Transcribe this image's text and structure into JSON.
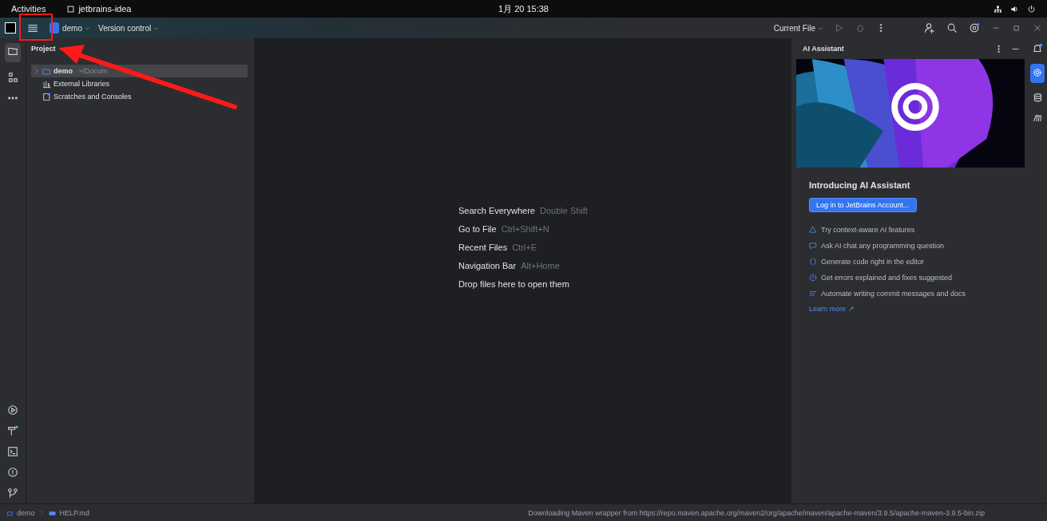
{
  "system_bar": {
    "activities": "Activities",
    "app_name": "jetbrains-idea",
    "clock": "1月 20 15:38"
  },
  "title_bar": {
    "project": "demo",
    "vcs": "Version control",
    "run_config": "Current File"
  },
  "project_panel": {
    "title": "Project",
    "tree": [
      {
        "label": "demo",
        "path": "~/Docum",
        "kind": "module",
        "selected": true
      },
      {
        "label": "External Libraries",
        "kind": "libraries",
        "selected": false
      },
      {
        "label": "Scratches and Consoles",
        "kind": "scratches",
        "selected": false
      }
    ]
  },
  "editor_hints": [
    {
      "action": "Search Everywhere",
      "shortcut": "Double Shift"
    },
    {
      "action": "Go to File",
      "shortcut": "Ctrl+Shift+N"
    },
    {
      "action": "Recent Files",
      "shortcut": "Ctrl+E"
    },
    {
      "action": "Navigation Bar",
      "shortcut": "Alt+Home"
    },
    {
      "action": "Drop files here to open them"
    }
  ],
  "ai_panel": {
    "title": "AI Assistant",
    "heading": "Introducing AI Assistant",
    "login_button": "Log in to JetBrains Account...",
    "features": [
      {
        "text": "Try context-aware AI features",
        "kind": "context"
      },
      {
        "text": "Ask AI chat any programming question",
        "kind": "chat"
      },
      {
        "text": "Generate code right in the editor",
        "kind": "code"
      },
      {
        "text": "Get errors explained and fixes suggested",
        "kind": "errors"
      },
      {
        "text": "Automate writing commit messages and docs",
        "kind": "commit"
      }
    ],
    "learn_more": "Learn more ↗"
  },
  "status_bar": {
    "breadcrumbs": [
      "demo",
      "HELP.md"
    ],
    "message": "Downloading Maven wrapper from https://repo.maven.apache.org/maven2/org/apache/maven/apache-maven/3.9.5/apache-maven-3.9.5-bin.zip"
  }
}
